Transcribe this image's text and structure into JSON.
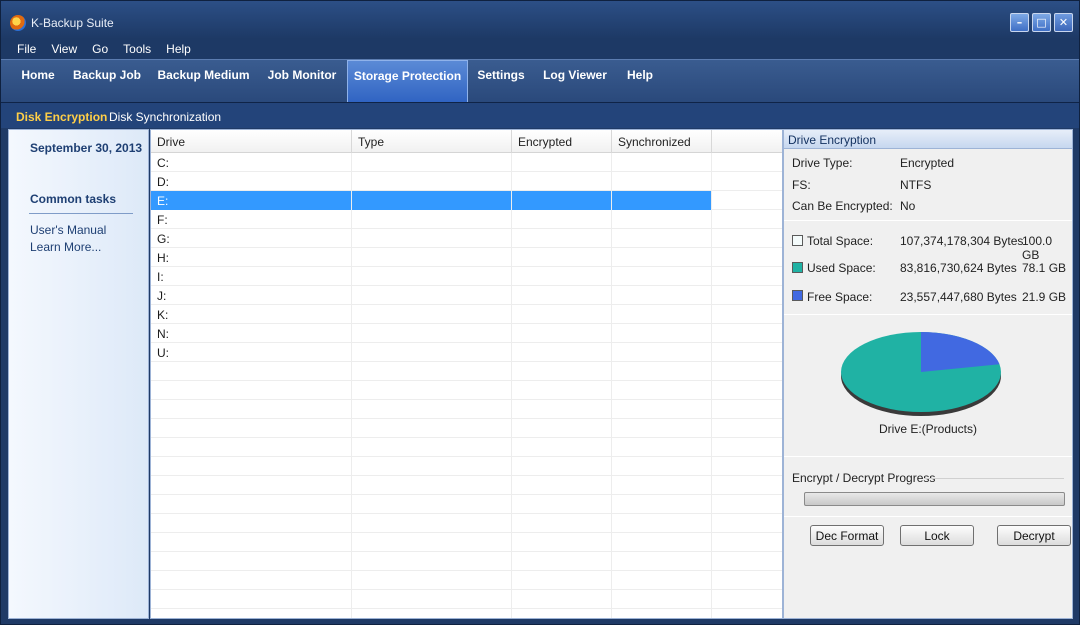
{
  "window": {
    "title": "K-Backup Suite",
    "controls": [
      "minimize-icon",
      "maximize-icon",
      "close-icon"
    ]
  },
  "menubar": {
    "items": [
      {
        "label": "File"
      },
      {
        "label": "View"
      },
      {
        "label": "Go"
      },
      {
        "label": "Tools"
      },
      {
        "label": "Help"
      }
    ]
  },
  "nav": {
    "tabs": [
      {
        "label": "Home"
      },
      {
        "label": "Backup Job"
      },
      {
        "label": "Backup Medium"
      },
      {
        "label": "Job Monitor"
      },
      {
        "label": "Storage Protection",
        "active": true
      },
      {
        "label": "Settings"
      },
      {
        "label": "Log Viewer"
      },
      {
        "label": "Help"
      }
    ]
  },
  "subnav": {
    "items": [
      {
        "label": "Disk Encryption",
        "active": true
      },
      {
        "label": "Disk Synchronization"
      }
    ]
  },
  "leftpane": {
    "date": "September 30, 2013",
    "common_tasks": "Common tasks",
    "links": [
      {
        "label": "User's Manual"
      },
      {
        "label": "Learn More..."
      }
    ]
  },
  "table": {
    "columns": [
      "Drive",
      "Type",
      "Encrypted",
      "Synchronized"
    ],
    "rows": [
      {
        "drive": "C:"
      },
      {
        "drive": "D:"
      },
      {
        "drive": "E:",
        "selected": true
      },
      {
        "drive": "F:"
      },
      {
        "drive": "G:"
      },
      {
        "drive": "H:"
      },
      {
        "drive": "I:"
      },
      {
        "drive": "J:"
      },
      {
        "drive": "K:"
      },
      {
        "drive": "N:"
      },
      {
        "drive": "U:"
      }
    ]
  },
  "drive_encryption": {
    "header": "Drive Encryption",
    "info": [
      {
        "label": "Drive Type:",
        "value": "Encrypted"
      },
      {
        "label": "FS:",
        "value": "NTFS"
      },
      {
        "label": "Can Be Encrypted:",
        "value": "No"
      }
    ],
    "space": [
      {
        "label": "Total Space:",
        "bytes": "107,374,178,304 Bytes",
        "gb": "100.0 GB",
        "color": "#f4fbfb"
      },
      {
        "label": "Used Space:",
        "bytes": "83,816,730,624 Bytes",
        "gb": "78.1 GB",
        "color": "#20b2a4"
      },
      {
        "label": "Free Space:",
        "bytes": "23,557,447,680 Bytes",
        "gb": "21.9 GB",
        "color": "#4169e1"
      }
    ],
    "pie": {
      "caption": "Drive E:(Products)",
      "used_fraction": 0.781,
      "free_fraction": 0.219,
      "used_color": "#20b2a4",
      "free_color": "#4169e1"
    },
    "progress": {
      "title": "Encrypt / Decrypt Progress",
      "value": 0
    },
    "buttons": [
      {
        "label": "Dec Format"
      },
      {
        "label": "Lock"
      },
      {
        "label": "Decrypt"
      }
    ]
  }
}
